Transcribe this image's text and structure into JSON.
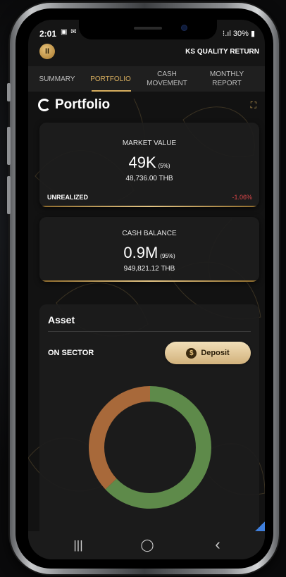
{
  "status": {
    "time": "2:01",
    "battery": "30%",
    "icons": "▣ ✉"
  },
  "account": {
    "avatar_initial": "II",
    "name": "KS QUALITY RETURN"
  },
  "tabs": [
    {
      "label": "SUMMARY",
      "active": false
    },
    {
      "label": "PORTFOLIO",
      "active": true
    },
    {
      "label": "CASH MOVEMENT",
      "active": false
    },
    {
      "label": "MONTHLY REPORT",
      "active": false
    }
  ],
  "page": {
    "title": "Portfolio"
  },
  "market_value": {
    "label": "MARKET VALUE",
    "amount": "49K",
    "percent": "(5%)",
    "thb": "48,736.00 THB",
    "unrealized_label": "UNREALIZED",
    "unrealized_value": "-1.06%"
  },
  "cash_balance": {
    "label": "CASH BALANCE",
    "amount": "0.9M",
    "percent": "(95%)",
    "thb": "949,821.12 THB"
  },
  "asset": {
    "title": "Asset",
    "sector_label": "ON SECTOR",
    "deposit_label": "Deposit",
    "donut": [
      {
        "share": 0.63,
        "color": "#5e8a4a"
      },
      {
        "share": 0.37,
        "color": "#a8693a"
      }
    ]
  },
  "colors": {
    "accent": "#d6ad5e",
    "negative": "#e0474a"
  },
  "navbar": {
    "recent": "|||",
    "home": "◯",
    "back": "‹"
  }
}
